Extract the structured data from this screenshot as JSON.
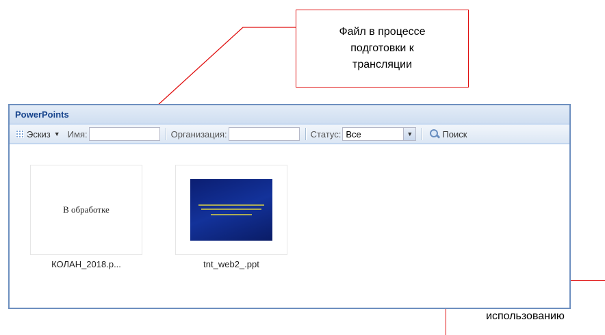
{
  "callouts": {
    "top": "Файл в процессе\nподготовки к\nтрансляции",
    "bottom": "Файл готовый к\nиспользованию"
  },
  "panel": {
    "title": "PowerPoints"
  },
  "toolbar": {
    "view_label": "Эскиз",
    "name_label": "Имя:",
    "name_value": "",
    "org_label": "Организация:",
    "org_value": "",
    "status_label": "Статус:",
    "status_value": "Все",
    "search_label": "Поиск"
  },
  "items": [
    {
      "status_text": "В обработке",
      "filename": "КОЛАН_2018.p..."
    },
    {
      "filename": "tnt_web2_.ppt"
    }
  ],
  "colors": {
    "annotation": "#e01010",
    "header_text": "#15428b",
    "slide_bg": "#13329a"
  }
}
